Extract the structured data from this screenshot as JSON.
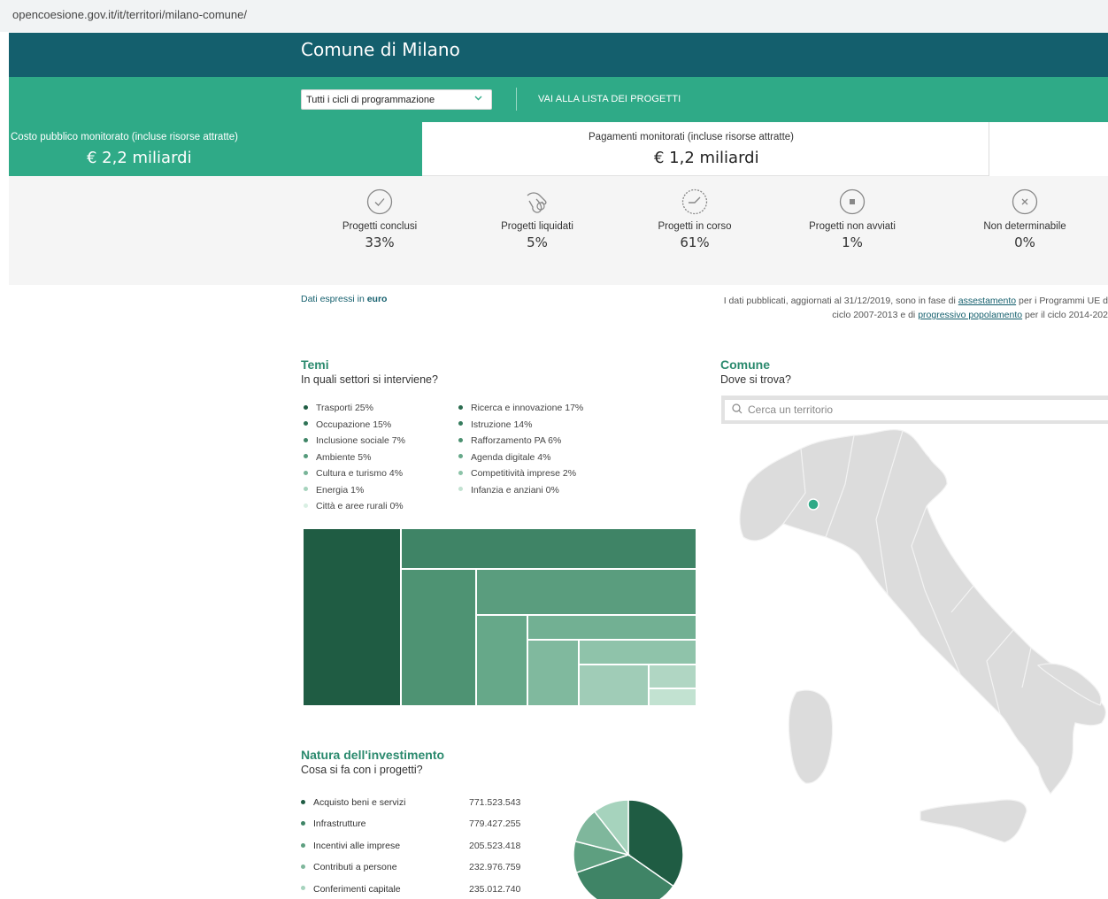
{
  "browser": {
    "url": "opencoesione.gov.it/it/territori/milano-comune/"
  },
  "header": {
    "title": "Comune di Milano"
  },
  "toolbar": {
    "cycle_select_value": "Tutti i cicli di programmazione",
    "projects_link": "VAI ALLA LISTA DEI PROGETTI"
  },
  "summary": {
    "costo_label": "Costo pubblico monitorato (incluse risorse attratte)",
    "costo_value": "€ 2,2 miliardi",
    "pagamenti_label": "Pagamenti monitorati (incluse risorse attratte)",
    "pagamenti_value": "€ 1,2 miliardi"
  },
  "status": [
    {
      "label": "Progetti conclusi",
      "pct": "33%",
      "icon": "check-circle-icon"
    },
    {
      "label": "Progetti liquidati",
      "pct": "5%",
      "icon": "hand-coin-icon"
    },
    {
      "label": "Progetti in corso",
      "pct": "61%",
      "icon": "progress-clock-icon"
    },
    {
      "label": "Progetti non avviati",
      "pct": "1%",
      "icon": "stop-circle-icon"
    },
    {
      "label": "Non determinabile",
      "pct": "0%",
      "icon": "x-circle-icon"
    }
  ],
  "info": {
    "dati_prefix": "Dati espressi in",
    "dati_unit": "euro",
    "note_line1_a": "I dati pubblicati, aggiornati al 31/12/2019, sono in fase di",
    "note_line1_link": "assestamento",
    "note_line1_b": "per i Programmi UE d",
    "note_line2_a": "ciclo 2007-2013 e di",
    "note_line2_link": "progressivo popolamento",
    "note_line2_b": "per il ciclo 2014-202"
  },
  "temi": {
    "title": "Temi",
    "subtitle": "In quali settori si interviene?",
    "legend_left": [
      {
        "label": "Trasporti 25%",
        "color": "#1f5c43"
      },
      {
        "label": "Occupazione 15%",
        "color": "#2f7356"
      },
      {
        "label": "Inclusione sociale 7%",
        "color": "#3f8466"
      },
      {
        "label": "Ambiente 5%",
        "color": "#559a7b"
      },
      {
        "label": "Cultura e turismo 4%",
        "color": "#78b498"
      },
      {
        "label": "Energia 1%",
        "color": "#a6d3bd"
      },
      {
        "label": "Città e aree rurali 0%",
        "color": "#d9efe3"
      }
    ],
    "legend_right": [
      {
        "label": "Ricerca e innovazione 17%",
        "color": "#2a6b4e"
      },
      {
        "label": "Istruzione 14%",
        "color": "#367c5e"
      },
      {
        "label": "Rafforzamento PA 6%",
        "color": "#4b9070"
      },
      {
        "label": "Agenda digitale 4%",
        "color": "#66a889"
      },
      {
        "label": "Competitività imprese 2%",
        "color": "#8cc3a8"
      },
      {
        "label": "Infanzia e anziani 0%",
        "color": "#c2e2d1"
      }
    ]
  },
  "natura": {
    "title": "Natura dell'investimento",
    "subtitle": "Cosa si fa con i progetti?",
    "items": [
      {
        "label": "Acquisto beni e servizi",
        "amount": "771.523.543",
        "value": 771523543,
        "color": "#1f5c43"
      },
      {
        "label": "Infrastrutture",
        "amount": "779.427.255",
        "value": 779427255,
        "color": "#3f8466"
      },
      {
        "label": "Incentivi alle imprese",
        "amount": "205.523.418",
        "value": 205523418,
        "color": "#5e9f80"
      },
      {
        "label": "Contributi a persone",
        "amount": "232.976.759",
        "value": 232976759,
        "color": "#7fb79c"
      },
      {
        "label": "Conferimenti capitale",
        "amount": "235.012.740",
        "value": 235012740,
        "color": "#a6d3bd"
      }
    ]
  },
  "comune": {
    "title": "Comune",
    "subtitle": "Dove si trova?",
    "search_placeholder": "Cerca un territorio"
  }
}
